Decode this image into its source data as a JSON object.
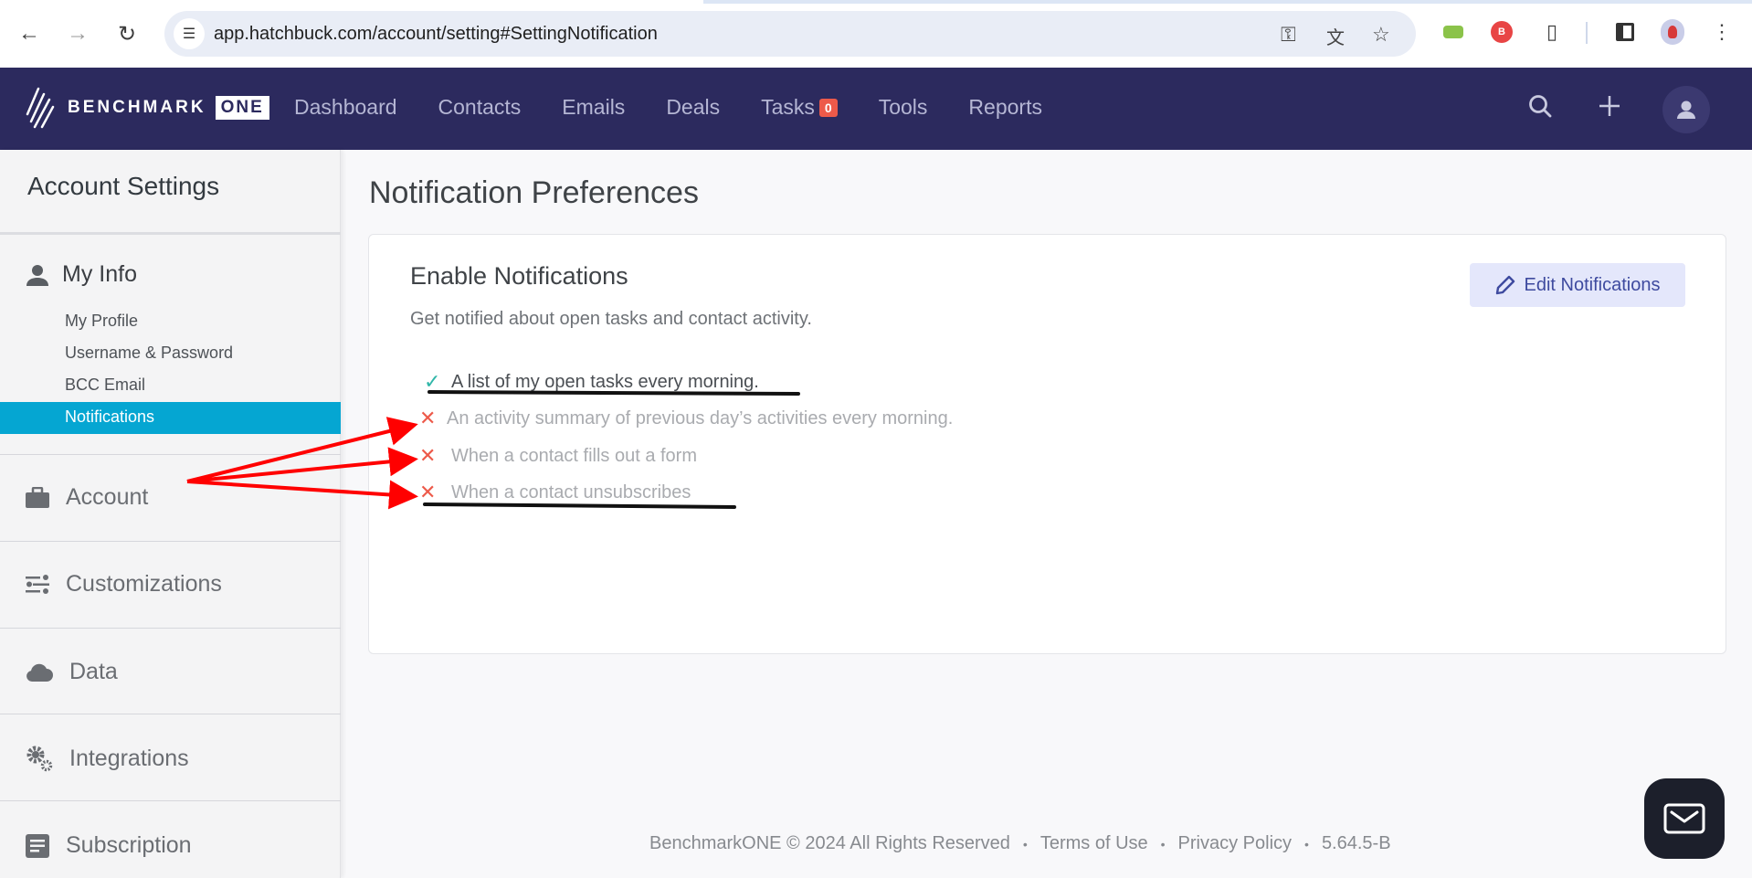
{
  "browser": {
    "url": "app.hatchbuck.com/account/setting#SettingNotification",
    "icons": [
      "back-icon",
      "forward-icon",
      "reload-icon",
      "site-settings-icon",
      "password-key-icon",
      "translate-icon",
      "bookmark-star-icon",
      "video-extension-icon",
      "benchmark-extension-icon",
      "extensions-puzzle-icon",
      "side-panel-icon",
      "profile-avatar-icon",
      "menu-kebab-icon"
    ]
  },
  "app_nav": {
    "logo_word": "BENCHMARK",
    "logo_one": "ONE",
    "items": [
      {
        "label": "Dashboard"
      },
      {
        "label": "Contacts"
      },
      {
        "label": "Emails"
      },
      {
        "label": "Deals"
      },
      {
        "label": "Tasks",
        "badge": "0"
      },
      {
        "label": "Tools"
      },
      {
        "label": "Reports"
      }
    ]
  },
  "sidebar": {
    "title": "Account Settings",
    "my_info": {
      "label": "My Info",
      "items": [
        "My Profile",
        "Username & Password",
        "BCC Email",
        "Notifications"
      ],
      "active": "Notifications"
    },
    "sections": [
      {
        "label": "Account",
        "icon": "briefcase-icon"
      },
      {
        "label": "Customizations",
        "icon": "sliders-icon"
      },
      {
        "label": "Data",
        "icon": "cloud-icon"
      },
      {
        "label": "Integrations",
        "icon": "gears-icon"
      },
      {
        "label": "Subscription",
        "icon": "document-icon"
      }
    ]
  },
  "main": {
    "title": "Notification Preferences",
    "card": {
      "title": "Enable Notifications",
      "subtitle": "Get notified about open tasks and contact activity.",
      "edit_button": "Edit Notifications",
      "options": [
        {
          "label": "A list of my open tasks every morning.",
          "enabled": true
        },
        {
          "label": "An activity summary of previous day’s activities every morning.",
          "enabled": false
        },
        {
          "label": "When a contact fills out a form",
          "enabled": false
        },
        {
          "label": "When a contact unsubscribes",
          "enabled": false
        }
      ]
    }
  },
  "footer": {
    "copyright": "BenchmarkONE © 2024 All Rights Reserved",
    "terms": "Terms of Use",
    "privacy": "Privacy Policy",
    "version": "5.64.5-B",
    "separator": "•"
  },
  "colors": {
    "nav_bg": "#2c2a5e",
    "active_item": "#05a6d2",
    "badge": "#ed5a4a",
    "check": "#2fb6a8",
    "cross": "#ed5a4a",
    "edit_button_bg": "#e4e7fb",
    "annotation_arrow": "#ff0000"
  }
}
